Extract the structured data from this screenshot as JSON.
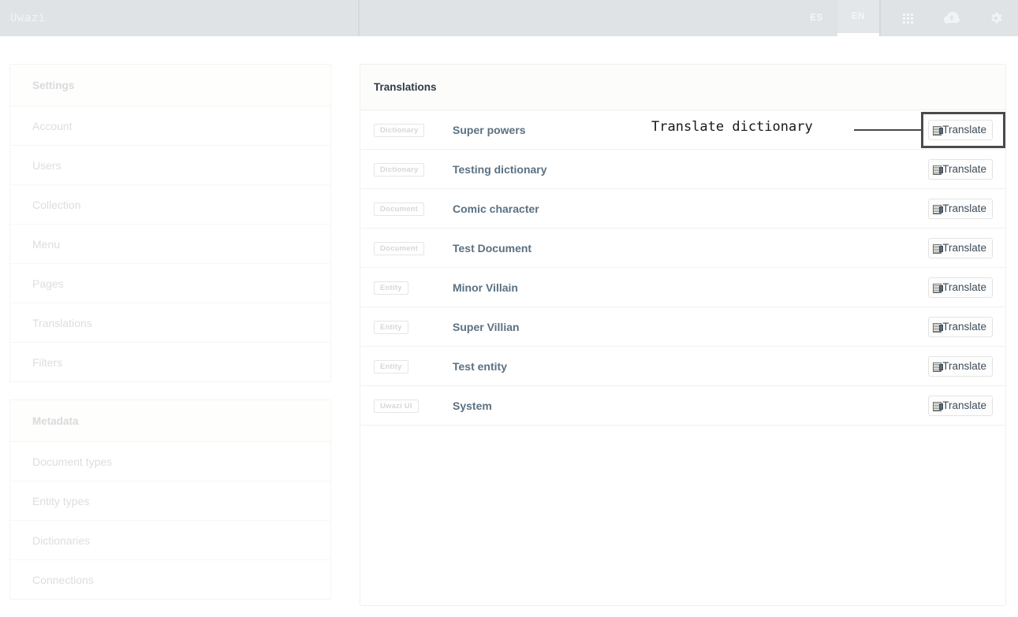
{
  "topbar": {
    "brand": "Uwazi",
    "languages": [
      {
        "label": "ES",
        "active": false
      },
      {
        "label": "EN",
        "active": true
      }
    ],
    "icons": [
      {
        "name": "grid-icon"
      },
      {
        "name": "cloud-upload-icon"
      },
      {
        "name": "gear-icon"
      }
    ]
  },
  "sidebar": {
    "groups": [
      {
        "title": "Settings",
        "items": [
          {
            "label": "Account"
          },
          {
            "label": "Users"
          },
          {
            "label": "Collection"
          },
          {
            "label": "Menu"
          },
          {
            "label": "Pages"
          },
          {
            "label": "Translations"
          },
          {
            "label": "Filters"
          }
        ]
      },
      {
        "title": "Metadata",
        "items": [
          {
            "label": "Document types"
          },
          {
            "label": "Entity types"
          },
          {
            "label": "Dictionaries"
          },
          {
            "label": "Connections"
          }
        ]
      }
    ]
  },
  "main": {
    "header": "Translations",
    "action_label": "Translate",
    "rows": [
      {
        "badge": "Dictionary",
        "title": "Super powers",
        "action": "Translate",
        "highlighted": true
      },
      {
        "badge": "Dictionary",
        "title": "Testing dictionary",
        "action": "Translate",
        "highlighted": false
      },
      {
        "badge": "Document",
        "title": "Comic character",
        "action": "Translate",
        "highlighted": false
      },
      {
        "badge": "Document",
        "title": "Test Document",
        "action": "Translate",
        "highlighted": false
      },
      {
        "badge": "Entity",
        "title": "Minor Villain",
        "action": "Translate",
        "highlighted": false
      },
      {
        "badge": "Entity",
        "title": "Super Villian",
        "action": "Translate",
        "highlighted": false
      },
      {
        "badge": "Entity",
        "title": "Test entity",
        "action": "Translate",
        "highlighted": false
      },
      {
        "badge": "Uwazi UI",
        "title": "System",
        "action": "Translate",
        "highlighted": false
      }
    ]
  },
  "annotation": {
    "label": "Translate dictionary",
    "target": "Translate"
  },
  "colors": {
    "topbar_bg": "#dfe3e6",
    "row_title": "#5b7182",
    "badge_text": "#d5d7da",
    "annotation": "#4a4a4a",
    "sidebar_text": "#dcdee1"
  }
}
